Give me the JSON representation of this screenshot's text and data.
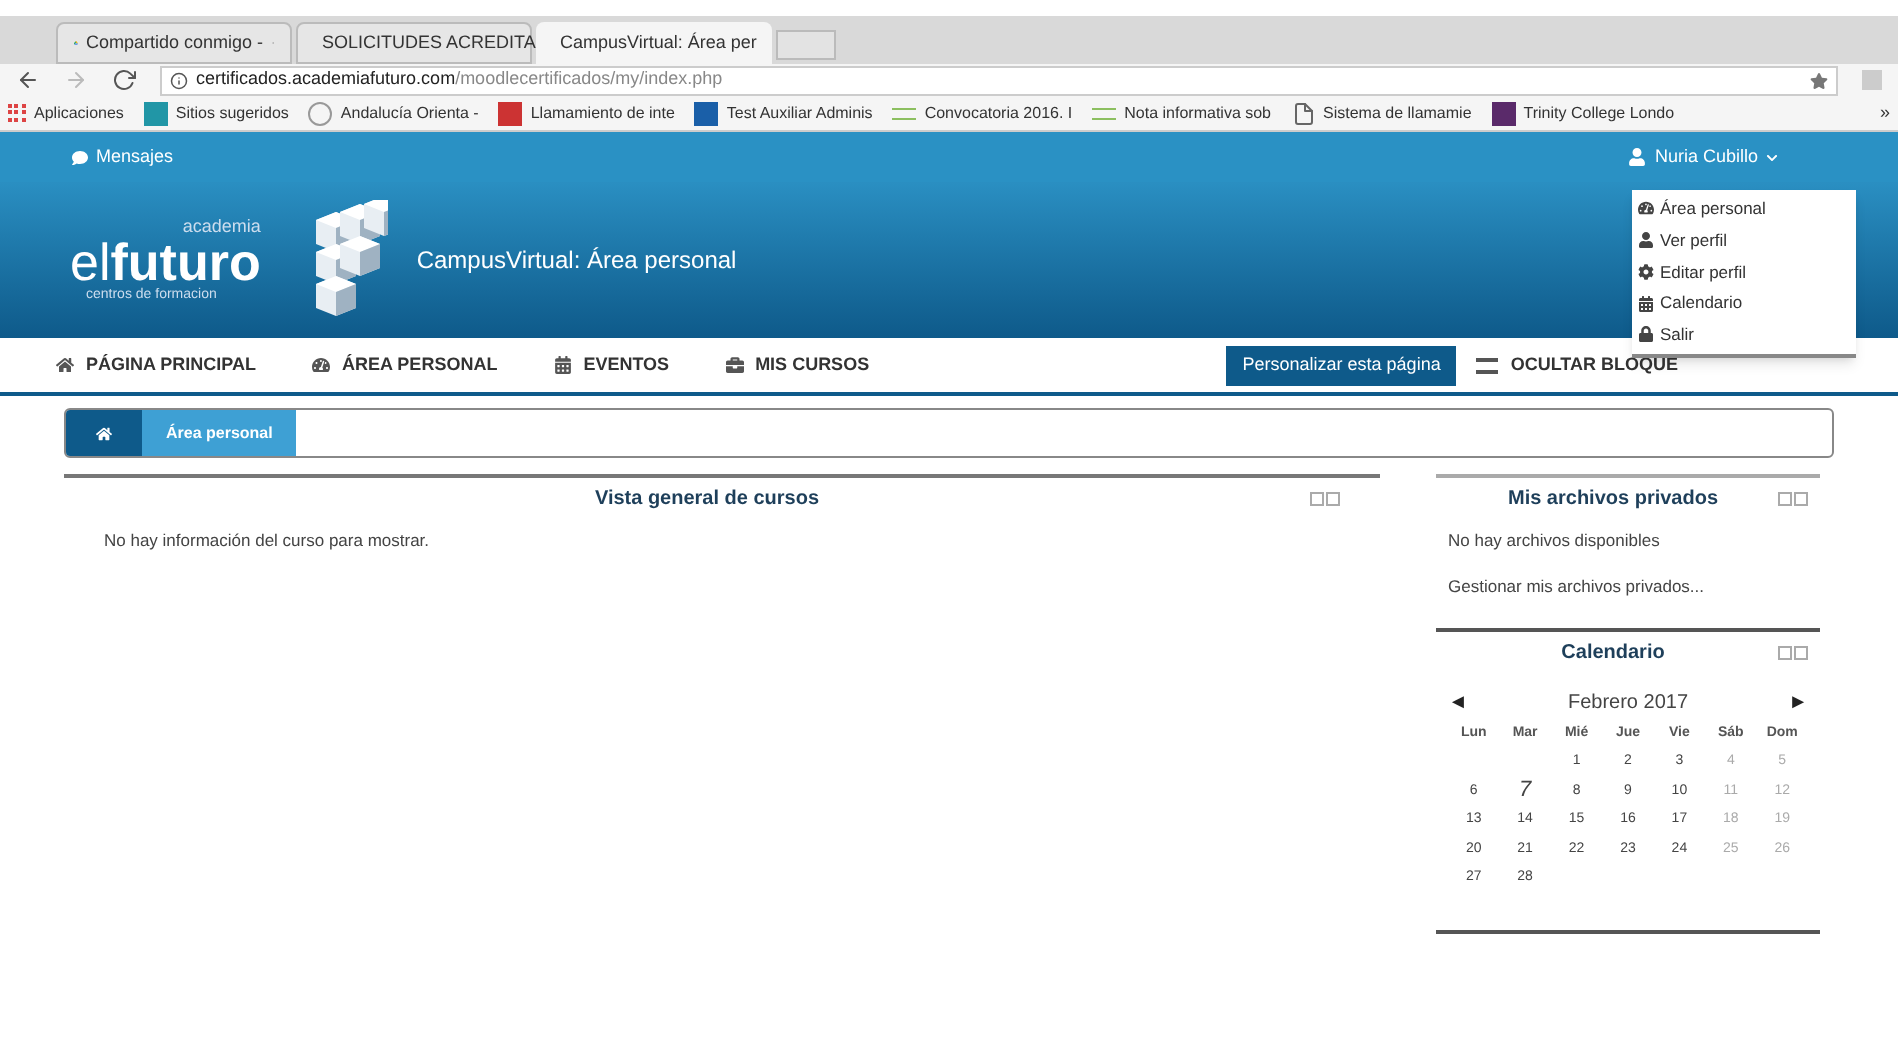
{
  "browser": {
    "tabs": [
      {
        "title": "Compartido conmigo - ",
        "selected": false,
        "kind": "drive"
      },
      {
        "title": "SOLICITUDES ACREDITA",
        "selected": false,
        "kind": "sheet"
      },
      {
        "title": "CampusVirtual: Área per",
        "selected": true,
        "kind": "moodle"
      }
    ],
    "url_host": "certificados.academiafuturo.com",
    "url_path": "/moodlecertificados/my/index.php",
    "bookmarks": [
      {
        "label": "Aplicaciones",
        "kind": "apps"
      },
      {
        "label": "Sitios sugeridos",
        "kind": "b"
      },
      {
        "label": "Andalucía Orienta - ",
        "kind": "ao"
      },
      {
        "label": "Llamamiento de inte",
        "kind": "flag"
      },
      {
        "label": "Test Auxiliar Adminis",
        "kind": "ht"
      },
      {
        "label": "Convocatoria 2016. I",
        "kind": "doc"
      },
      {
        "label": "Nota informativa sob",
        "kind": "doc"
      },
      {
        "label": "Sistema de llamamie",
        "kind": "page"
      },
      {
        "label": "Trinity College Londo",
        "kind": "tc"
      }
    ],
    "bookmarks_more": "»"
  },
  "topbar": {
    "messages": "Mensajes",
    "user": "Nuria Cubillo"
  },
  "user_menu": [
    {
      "label": "Área personal",
      "kind": "dashboard"
    },
    {
      "label": "Ver perfil",
      "kind": "user"
    },
    {
      "label": "Editar perfil",
      "kind": "gear"
    },
    {
      "label": "Calendario",
      "kind": "calendar"
    },
    {
      "label": "Salir",
      "kind": "lock"
    }
  ],
  "header": {
    "logo_academia": "academia",
    "logo_el": "el",
    "logo_futuro": "futuro",
    "logo_centros": "centros de formacion",
    "title": "CampusVirtual: Área personal"
  },
  "nav": [
    {
      "label": "PÁGINA PRINCIPAL",
      "kind": "home"
    },
    {
      "label": "ÁREA PERSONAL",
      "kind": "dashboard"
    },
    {
      "label": "EVENTOS",
      "kind": "calendar"
    },
    {
      "label": "MIS CURSOS",
      "kind": "briefcase"
    }
  ],
  "customize_button": "Personalizar esta página",
  "hide_blocks": "OCULTAR BLOQUE",
  "breadcrumb": [
    "Área personal"
  ],
  "main_block": {
    "title": "Vista general de cursos",
    "text": "No hay información del curso para mostrar."
  },
  "files_block": {
    "title": "Mis archivos privados",
    "text": "No hay archivos disponibles",
    "link": "Gestionar mis archivos privados..."
  },
  "calendar_block": {
    "title": "Calendario",
    "prev": "◄",
    "month": "Febrero 2017",
    "next": "►",
    "weekdays": [
      "Lun",
      "Mar",
      "Mié",
      "Jue",
      "Vie",
      "Sáb",
      "Dom"
    ],
    "weeks": [
      [
        {
          "day": "1",
          "today": false
        },
        {
          "day": "2",
          "today": false
        },
        {
          "day": "3",
          "today": false
        },
        {
          "day": "4",
          "today": false
        },
        {
          "day": "5",
          "today": false
        }
      ],
      [
        {
          "day": "6",
          "today": false
        },
        {
          "day": "7",
          "today": true
        },
        {
          "day": "8",
          "today": false
        },
        {
          "day": "9",
          "today": false
        },
        {
          "day": "10",
          "today": false
        },
        {
          "day": "11",
          "today": false
        },
        {
          "day": "12",
          "today": false
        }
      ],
      [
        {
          "day": "13",
          "today": false
        },
        {
          "day": "14",
          "today": false
        },
        {
          "day": "15",
          "today": false
        },
        {
          "day": "16",
          "today": false
        },
        {
          "day": "17",
          "today": false
        },
        {
          "day": "18",
          "today": false
        },
        {
          "day": "19",
          "today": false
        }
      ],
      [
        {
          "day": "20",
          "today": false
        },
        {
          "day": "21",
          "today": false
        },
        {
          "day": "22",
          "today": false
        },
        {
          "day": "23",
          "today": false
        },
        {
          "day": "24",
          "today": false
        },
        {
          "day": "25",
          "today": false
        },
        {
          "day": "26",
          "today": false
        }
      ],
      [
        {
          "day": "27",
          "today": false
        },
        {
          "day": "28",
          "today": false
        }
      ]
    ]
  }
}
